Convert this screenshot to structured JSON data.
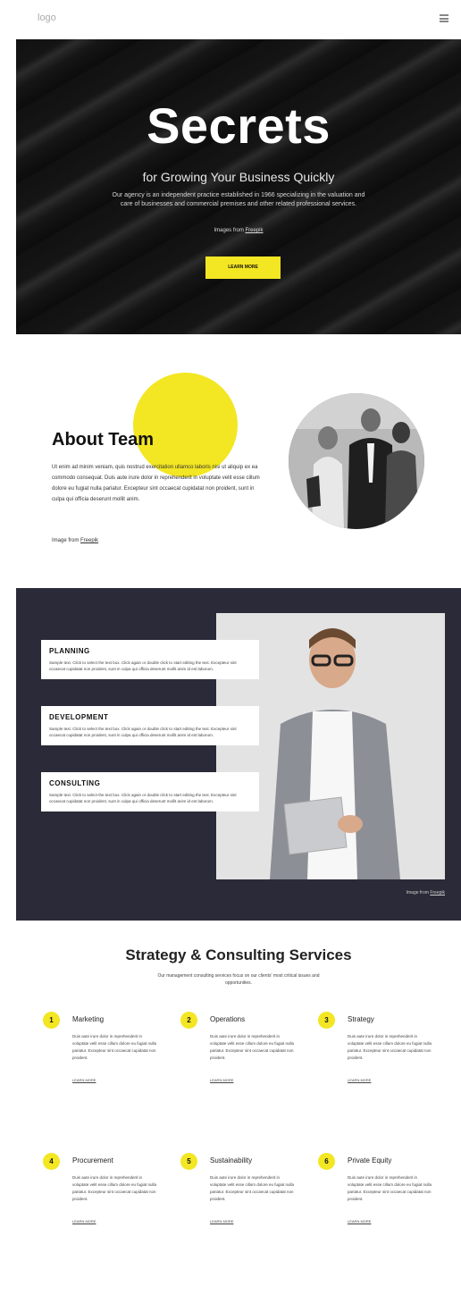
{
  "header": {
    "logo": "logo",
    "menu_icon": "hamburger-menu-icon"
  },
  "hero": {
    "title": "Secrets",
    "subtitle": "for Growing Your Business Quickly",
    "text": "Our agency is an independent practice established in 1966 specializing in the valuation and care of businesses and commercial premises and other related professional services.",
    "credit_prefix": "Images from ",
    "credit_link": "Freepik",
    "button": "LEARN MORE"
  },
  "about": {
    "title": "About Team",
    "text": "Ut enim ad minim veniam, quis nostrud exercitation ullamco laboris nisi ut aliquip ex ea commodo consequat. Duis aute irure dolor in reprehenderit in voluptate velit esse cillum dolore eu fugiat nulla pariatur. Excepteur sint occaecat cupidatat non proident, sunt in culpa qui officia deserunt mollit anim.",
    "credit_prefix": "Image from ",
    "credit_link": "Freepik"
  },
  "services": {
    "cards": [
      {
        "title": "PLANNING",
        "text": "Sample text. Click to select the text box. Click again or double click to start editing the text. Excepteur sint occaecat cupidatat non proident, sunt in culpa qui officia deserunt mollit anim id est laborum."
      },
      {
        "title": "DEVELOPMENT",
        "text": "Sample text. Click to select the text box. Click again or double click to start editing the text. Excepteur sint occaecat cupidatat non proident, sunt in culpa qui officia deserunt mollit anim id est laborum."
      },
      {
        "title": "CONSULTING",
        "text": "Sample text. Click to select the text box. Click again or double click to start editing the text. Excepteur sint occaecat cupidatat non proident, sunt in culpa qui officia deserunt mollit anim id est laborum."
      }
    ],
    "credit_prefix": "Image from ",
    "credit_link": "Freepik"
  },
  "strategy": {
    "title": "Strategy & Consulting Services",
    "subtitle": "Our management consulting services focus on our clients' most critical issues and opportunities.",
    "items": [
      {
        "num": "1",
        "title": "Marketing",
        "text": "Duis aute irure dolor in reprehenderit in voluptate velit esse cillum dolore eu fugiat nulla pariatur. Excepteur sint occaecat cupidatat non proident.",
        "link": "LEARN MORE"
      },
      {
        "num": "2",
        "title": "Operations",
        "text": "Duis aute irure dolor in reprehenderit in voluptate velit esse cillum dolore eu fugiat nulla pariatur. Excepteur sint occaecat cupidatat non proident.",
        "link": "LEARN MORE"
      },
      {
        "num": "3",
        "title": "Strategy",
        "text": "Duis aute irure dolor in reprehenderit in voluptate velit esse cillum dolore eu fugiat nulla pariatur. Excepteur sint occaecat cupidatat non proident.",
        "link": "LEARN MORE"
      },
      {
        "num": "4",
        "title": "Procurement",
        "text": "Duis aute irure dolor in reprehenderit in voluptate velit esse cillum dolore eu fugiat nulla pariatur. Excepteur sint occaecat cupidatat non proident.",
        "link": "LEARN MORE"
      },
      {
        "num": "5",
        "title": "Sustainability",
        "text": "Duis aute irure dolor in reprehenderit in voluptate velit esse cillum dolore eu fugiat nulla pariatur. Excepteur sint occaecat cupidatat non proident.",
        "link": "LEARN MORE"
      },
      {
        "num": "6",
        "title": "Private Equity",
        "text": "Duis aute irure dolor in reprehenderit in voluptate velit esse cillum dolore eu fugiat nulla pariatur. Excepteur sint occaecat cupidatat non proident.",
        "link": "LEARN MORE"
      }
    ]
  },
  "colors": {
    "accent": "#f3e623",
    "dark": "#2b2a38"
  }
}
